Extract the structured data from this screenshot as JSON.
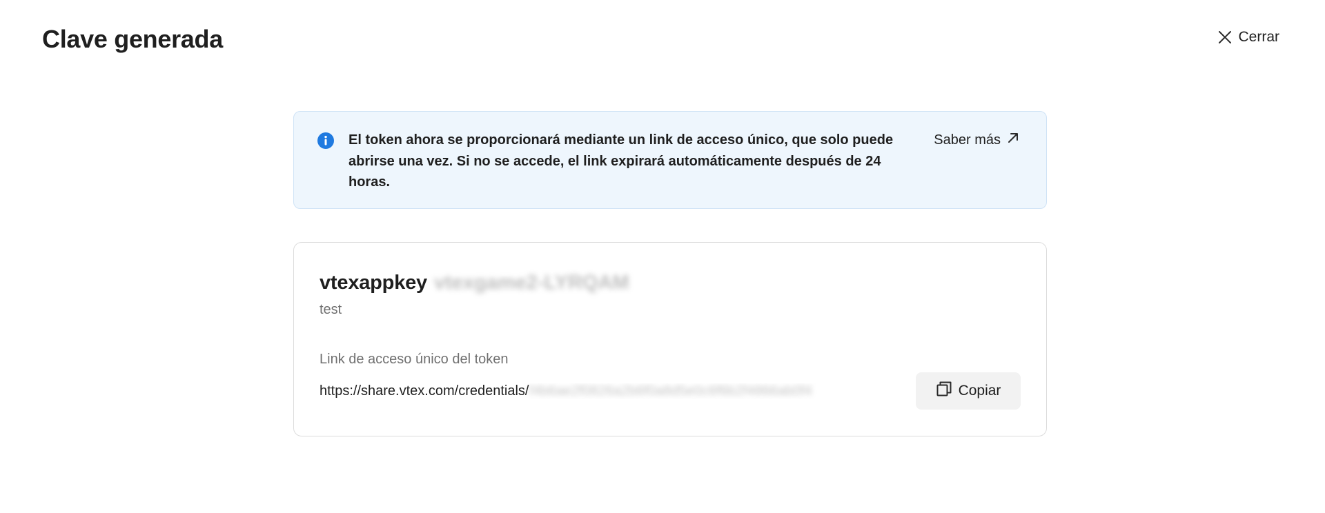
{
  "header": {
    "title": "Clave generada",
    "close_label": "Cerrar"
  },
  "info_alert": {
    "text": "El token ahora se proporcionará mediante un link de acceso único, que solo puede abrirse una vez. Si no se accede, el link expirará automáticamente después de 24 horas.",
    "learn_more_label": "Saber más",
    "accent_color": "#1f7ae0"
  },
  "key_card": {
    "key_name": "vtexappkey",
    "key_suffix_redacted": "vtexgame2-LYRQAM",
    "label": "test",
    "link_caption": "Link de acceso único del token",
    "link_prefix": "https://share.vtex.com/credentials/",
    "link_rest_redacted": "f4b6ae2f0826a2b6f0a8d5e0c6f6b2f4866ab0f4",
    "copy_label": "Copiar"
  }
}
